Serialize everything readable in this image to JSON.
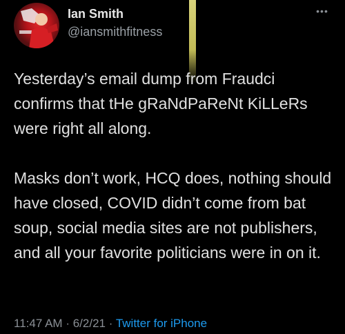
{
  "author": {
    "name": "Ian Smith",
    "handle": "@iansmithfitness"
  },
  "more_menu_icon": "more-horizontal-icon",
  "tweet": {
    "paragraphs": [
      "Yesterday’s email dump from Fraudci confirms that tHe gRaNdPaReNt KiLLeRs were right all along.",
      "Masks don’t work, HCQ does, nothing should have closed, COVID didn’t come from bat soup, social media sites are not publishers, and all your favorite politicians were in on it."
    ]
  },
  "meta": {
    "time": "11:47 AM",
    "separator": "·",
    "date": "6/2/21",
    "separator2": "·",
    "source": "Twitter for iPhone"
  },
  "colors": {
    "background": "#000000",
    "text": "#e0e0e0",
    "muted": "#8b9096",
    "link": "#1d9bf0"
  }
}
